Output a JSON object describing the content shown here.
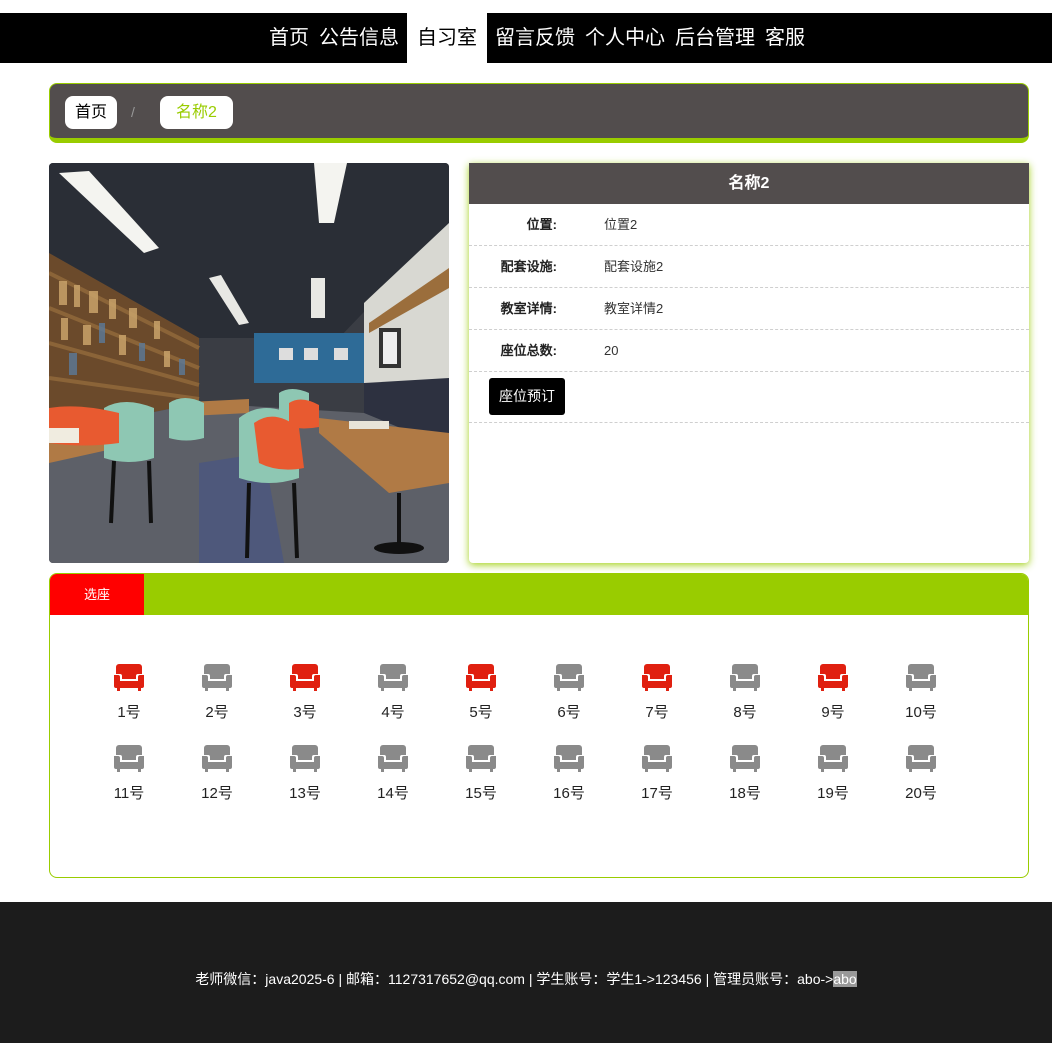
{
  "nav": [
    {
      "label": "首页",
      "active": false
    },
    {
      "label": "公告信息",
      "active": false
    },
    {
      "label": "自习室",
      "active": true
    },
    {
      "label": "留言反馈",
      "active": false
    },
    {
      "label": "个人中心",
      "active": false
    },
    {
      "label": "后台管理",
      "active": false
    },
    {
      "label": "客服",
      "active": false
    }
  ],
  "breadcrumb": {
    "home": "首页",
    "separator": "/",
    "current": "名称2"
  },
  "detail": {
    "title": "名称2",
    "rows": [
      {
        "key": "位置:",
        "value": "位置2"
      },
      {
        "key": "配套设施:",
        "value": "配套设施2"
      },
      {
        "key": "教室详情:",
        "value": "教室详情2"
      },
      {
        "key": "座位总数:",
        "value": "20"
      }
    ],
    "reserve_label": "座位预订"
  },
  "seats": {
    "tab_label": "选座",
    "colors": {
      "taken": "#e02010",
      "free": "#8a8a8a"
    },
    "items": [
      {
        "label": "1号",
        "taken": true
      },
      {
        "label": "2号",
        "taken": false
      },
      {
        "label": "3号",
        "taken": true
      },
      {
        "label": "4号",
        "taken": false
      },
      {
        "label": "5号",
        "taken": true
      },
      {
        "label": "6号",
        "taken": false
      },
      {
        "label": "7号",
        "taken": true
      },
      {
        "label": "8号",
        "taken": false
      },
      {
        "label": "9号",
        "taken": true
      },
      {
        "label": "10号",
        "taken": false
      },
      {
        "label": "11号",
        "taken": false
      },
      {
        "label": "12号",
        "taken": false
      },
      {
        "label": "13号",
        "taken": false
      },
      {
        "label": "14号",
        "taken": false
      },
      {
        "label": "15号",
        "taken": false
      },
      {
        "label": "16号",
        "taken": false
      },
      {
        "label": "17号",
        "taken": false
      },
      {
        "label": "18号",
        "taken": false
      },
      {
        "label": "19号",
        "taken": false
      },
      {
        "label": "20号",
        "taken": false
      }
    ]
  },
  "footer": {
    "text_main": "老师微信：java2025-6 | 邮箱：1127317652@qq.com | 学生账号：学生1->123456 | 管理员账号：abo->",
    "text_highlight": "abo"
  },
  "theme": {
    "accent": "#99cc00",
    "dark": "#524d4d",
    "footer": "#1c1c1c"
  }
}
